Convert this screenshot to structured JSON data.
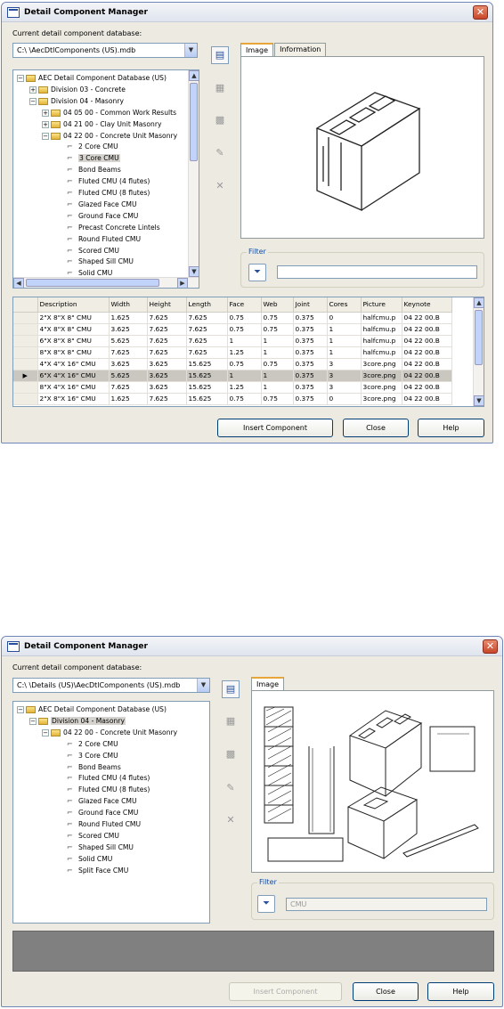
{
  "dialog1": {
    "title": "Detail Component Manager",
    "db_label": "Current detail component database:",
    "db_value": "C:\\ \\AecDtlComponents (US).mdb",
    "tree": [
      {
        "label": "AEC Detail Component Database (US)",
        "pm": "−",
        "icon": "folder"
      },
      {
        "label": "Division 03 - Concrete",
        "pm": "+",
        "icon": "folder"
      },
      {
        "label": "Division 04 - Masonry",
        "pm": "−",
        "icon": "folder"
      },
      {
        "label": "04 05 00 - Common Work Results",
        "pm": "+",
        "icon": "folder"
      },
      {
        "label": "04 21 00 - Clay Unit Masonry",
        "pm": "+",
        "icon": "folder"
      },
      {
        "label": "04 22 00 - Concrete Unit Masonry",
        "pm": "−",
        "icon": "folder"
      },
      {
        "label": "2 Core CMU",
        "icon": "component"
      },
      {
        "label": "3 Core CMU",
        "icon": "component",
        "selected": true
      },
      {
        "label": "Bond Beams",
        "icon": "component"
      },
      {
        "label": "Fluted CMU (4 flutes)",
        "icon": "component"
      },
      {
        "label": "Fluted CMU (8 flutes)",
        "icon": "component"
      },
      {
        "label": "Glazed Face CMU",
        "icon": "component"
      },
      {
        "label": "Ground Face CMU",
        "icon": "component"
      },
      {
        "label": "Precast Concrete Lintels",
        "icon": "component"
      },
      {
        "label": "Round Fluted CMU",
        "icon": "component"
      },
      {
        "label": "Scored CMU",
        "icon": "component"
      },
      {
        "label": "Shaped Sill CMU",
        "icon": "component"
      },
      {
        "label": "Solid CMU",
        "icon": "component"
      }
    ],
    "tabs": [
      "Image",
      "Information"
    ],
    "filter_label": "Filter",
    "filter_value": "",
    "table": {
      "columns": [
        "Description",
        "Width",
        "Height",
        "Length",
        "Face",
        "Web",
        "Joint",
        "Cores",
        "Picture",
        "Keynote"
      ],
      "rows": [
        [
          "2\"X 8\"X 8\" CMU",
          "1.625",
          "7.625",
          "7.625",
          "0.75",
          "0.75",
          "0.375",
          "0",
          "halfcmu.p",
          "04 22 00.B"
        ],
        [
          "4\"X 8\"X 8\" CMU",
          "3.625",
          "7.625",
          "7.625",
          "0.75",
          "0.75",
          "0.375",
          "1",
          "halfcmu.p",
          "04 22 00.B"
        ],
        [
          "6\"X 8\"X 8\" CMU",
          "5.625",
          "7.625",
          "7.625",
          "1",
          "1",
          "0.375",
          "1",
          "halfcmu.p",
          "04 22 00.B"
        ],
        [
          "8\"X 8\"X 8\" CMU",
          "7.625",
          "7.625",
          "7.625",
          "1.25",
          "1",
          "0.375",
          "1",
          "halfcmu.p",
          "04 22 00.B"
        ],
        [
          "4\"X 4\"X 16\" CMU",
          "3.625",
          "3.625",
          "15.625",
          "0.75",
          "0.75",
          "0.375",
          "3",
          "3core.png",
          "04 22 00.B"
        ],
        [
          "6\"X 4\"X 16\" CMU",
          "5.625",
          "3.625",
          "15.625",
          "1",
          "1",
          "0.375",
          "3",
          "3core.png",
          "04 22 00.B"
        ],
        [
          "8\"X 4\"X 16\" CMU",
          "7.625",
          "3.625",
          "15.625",
          "1.25",
          "1",
          "0.375",
          "3",
          "3core.png",
          "04 22 00.B"
        ],
        [
          "2\"X 8\"X 16\" CMU",
          "1.625",
          "7.625",
          "15.625",
          "0.75",
          "0.75",
          "0.375",
          "0",
          "3core.png",
          "04 22 00.B"
        ]
      ],
      "current_row": 5
    },
    "buttons": {
      "insert": "Insert Component",
      "close": "Close",
      "help": "Help"
    }
  },
  "dialog2": {
    "title": "Detail Component Manager",
    "db_label": "Current detail component database:",
    "db_value": "C:\\ \\Details (US)\\AecDtlComponents (US).mdb",
    "tree": [
      {
        "label": "AEC Detail Component Database (US)",
        "pm": "−",
        "icon": "folder"
      },
      {
        "label": "Division 04 - Masonry",
        "pm": "−",
        "icon": "folder",
        "selected": true
      },
      {
        "label": "04 22 00 - Concrete Unit Masonry",
        "pm": "−",
        "icon": "folder"
      },
      {
        "label": "2 Core CMU",
        "icon": "component"
      },
      {
        "label": "3 Core CMU",
        "icon": "component"
      },
      {
        "label": "Bond Beams",
        "icon": "component"
      },
      {
        "label": "Fluted CMU (4 flutes)",
        "icon": "component"
      },
      {
        "label": "Fluted CMU (8 flutes)",
        "icon": "component"
      },
      {
        "label": "Glazed Face CMU",
        "icon": "component"
      },
      {
        "label": "Ground Face CMU",
        "icon": "component"
      },
      {
        "label": "Round Fluted CMU",
        "icon": "component"
      },
      {
        "label": "Scored CMU",
        "icon": "component"
      },
      {
        "label": "Shaped Sill CMU",
        "icon": "component"
      },
      {
        "label": "Solid CMU",
        "icon": "component"
      },
      {
        "label": "Split Face CMU",
        "icon": "component"
      }
    ],
    "tabs": [
      "Image"
    ],
    "filter_label": "Filter",
    "filter_value": "CMU",
    "buttons": {
      "insert": "Insert Component",
      "close": "Close",
      "help": "Help"
    }
  }
}
